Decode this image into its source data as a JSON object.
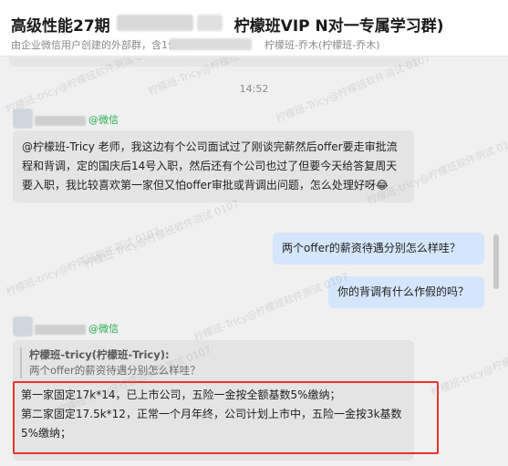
{
  "header": {
    "title_part1": "高级性能27期",
    "title_part2": "柠檬班VIP N对一专属学习群)",
    "subtitle_part1": "由企业微信用户创建的外部群，含1位外",
    "subtitle_part2": "柠檬班-乔木(柠檬班-乔木)"
  },
  "chat": {
    "timestamp": "14:52",
    "messages": [
      {
        "sender_suffix": "@微信",
        "text": "@柠檬班-Tricy  老师，我这边有个公司面试过了刚谈完薪然后offer要走审批流程和背调，定的国庆后14号入职，然后还有个公司也过了但要今天给答复周天要入职，我比较喜欢第一家但又怕offer审批或背调出问题，怎么处理好呀😂"
      },
      {
        "text": "两个offer的薪资待遇分别怎么样哇？"
      },
      {
        "text": "你的背调有什么作假的吗？"
      },
      {
        "sender_suffix": "@微信",
        "quote_name": "柠檬班-tricy(柠檬班-Tricy):",
        "quote_text": "两个offer的薪资待遇分别怎么样哇？",
        "reply_line1": "第一家固定17k*14，已上市公司，五险一金按全额基数5%缴纳；",
        "reply_line2": "第二家固定17.5k*12，正常一个月年终，公司计划上市中，五险一金按3k基数5%缴纳；"
      }
    ]
  },
  "watermarks": [
    "柠檬班-tricy@柠檬班软件测试 0107",
    "柠檬班-Tricy@柠檬班软件测试 0107",
    "柠檬班-tricy@柠檬班软件测试 0107",
    "柠檬班-Tricy@柠檬班软件测试 0107",
    "柠檬班-tricy@柠檬班软件测试 0107",
    "柠檬班-Tricy@柠檬班软件测试 0107",
    "柠檬班-tricy@柠檬班软件测试 0107",
    "柠檬班-Tricy@柠檬班软件测试 0107",
    "柠檬班-tricy@柠檬班软件测试 0107"
  ],
  "colors": {
    "accent_green": "#2bae4f",
    "own_bubble": "#d3e6fb",
    "other_bubble": "#e4e4e4",
    "highlight_box": "#e8342c"
  }
}
